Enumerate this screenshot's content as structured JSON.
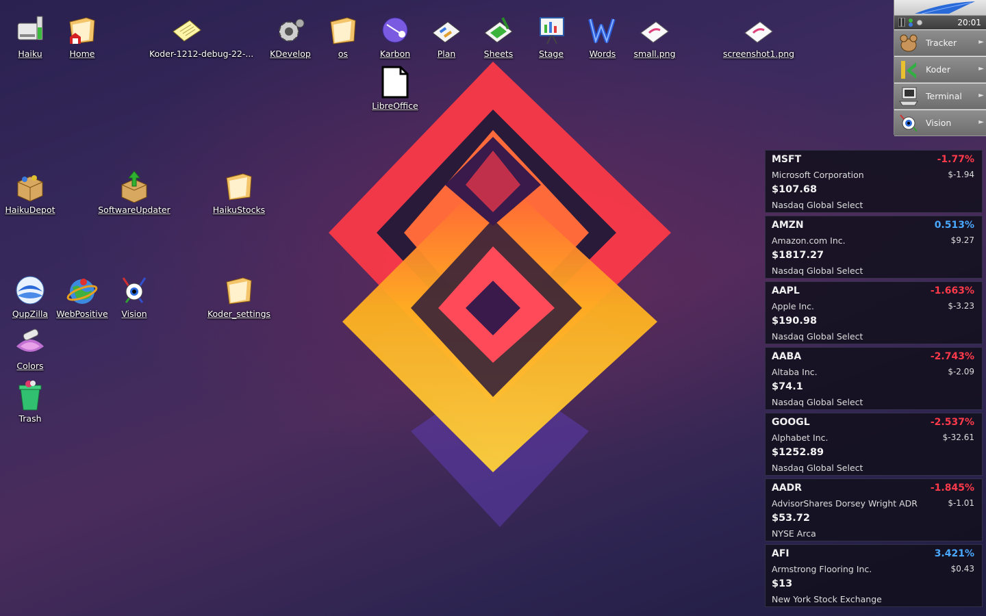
{
  "desktop_icons": [
    {
      "label": "Haiku",
      "icon": "haiku-volume-icon"
    },
    {
      "label": "Home",
      "icon": "home-folder-icon"
    },
    {
      "label": "Koder-1212-debug-22-...",
      "icon": "text-file-icon"
    },
    {
      "label": "KDevelop",
      "icon": "kdevelop-gear-icon"
    },
    {
      "label": "os",
      "icon": "folder-icon"
    },
    {
      "label": "Karbon",
      "icon": "karbon-icon"
    },
    {
      "label": "Plan",
      "icon": "plan-icon"
    },
    {
      "label": "Sheets",
      "icon": "sheets-icon"
    },
    {
      "label": "Stage",
      "icon": "stage-icon"
    },
    {
      "label": "Words",
      "icon": "words-icon"
    },
    {
      "label": "small.png",
      "icon": "image-file-icon"
    },
    {
      "label": "screenshot1.png",
      "icon": "image-file-icon"
    },
    {
      "label": "LibreOffice",
      "icon": "generic-file-icon"
    },
    {
      "label": "HaikuDepot",
      "icon": "package-icon"
    },
    {
      "label": "SoftwareUpdater",
      "icon": "updater-icon"
    },
    {
      "label": "HaikuStocks",
      "icon": "folder-icon"
    },
    {
      "label": "QupZilla",
      "icon": "qupzilla-icon"
    },
    {
      "label": "WebPositive",
      "icon": "webpositive-icon"
    },
    {
      "label": "Vision",
      "icon": "vision-eye-icon"
    },
    {
      "label": "Koder_settings",
      "icon": "folder-icon"
    },
    {
      "label": "Colors",
      "icon": "colors-icon"
    },
    {
      "label": "Trash",
      "icon": "trash-icon"
    }
  ],
  "deskbar": {
    "clock": "20:01",
    "items": [
      {
        "label": "Tracker",
        "icon": "tracker-icon"
      },
      {
        "label": "Koder",
        "icon": "koder-icon"
      },
      {
        "label": "Terminal",
        "icon": "terminal-icon"
      },
      {
        "label": "Vision",
        "icon": "vision-eye-icon"
      }
    ]
  },
  "stocks": [
    {
      "symbol": "MSFT",
      "percent": "-1.77%",
      "name": "Microsoft Corporation",
      "change": "$-1.94",
      "price": "$107.68",
      "exchange": "Nasdaq Global Select",
      "direction": "down"
    },
    {
      "symbol": "AMZN",
      "percent": "0.513%",
      "name": "Amazon.com Inc.",
      "change": "$9.27",
      "price": "$1817.27",
      "exchange": "Nasdaq Global Select",
      "direction": "up"
    },
    {
      "symbol": "AAPL",
      "percent": "-1.663%",
      "name": "Apple Inc.",
      "change": "$-3.23",
      "price": "$190.98",
      "exchange": "Nasdaq Global Select",
      "direction": "down"
    },
    {
      "symbol": "AABA",
      "percent": "-2.743%",
      "name": "Altaba Inc.",
      "change": "$-2.09",
      "price": "$74.1",
      "exchange": "Nasdaq Global Select",
      "direction": "down"
    },
    {
      "symbol": "GOOGL",
      "percent": "-2.537%",
      "name": "Alphabet Inc.",
      "change": "$-32.61",
      "price": "$1252.89",
      "exchange": "Nasdaq Global Select",
      "direction": "down"
    },
    {
      "symbol": "AADR",
      "percent": "-1.845%",
      "name": "AdvisorShares Dorsey Wright ADR",
      "change": "$-1.01",
      "price": "$53.72",
      "exchange": "NYSE Arca",
      "direction": "down"
    },
    {
      "symbol": "AFI",
      "percent": "3.421%",
      "name": "Armstrong Flooring Inc.",
      "change": "$0.43",
      "price": "$13",
      "exchange": "New York Stock Exchange",
      "direction": "up"
    }
  ],
  "colors": {
    "negative": "#ff3a4a",
    "positive": "#4aa8ff"
  }
}
